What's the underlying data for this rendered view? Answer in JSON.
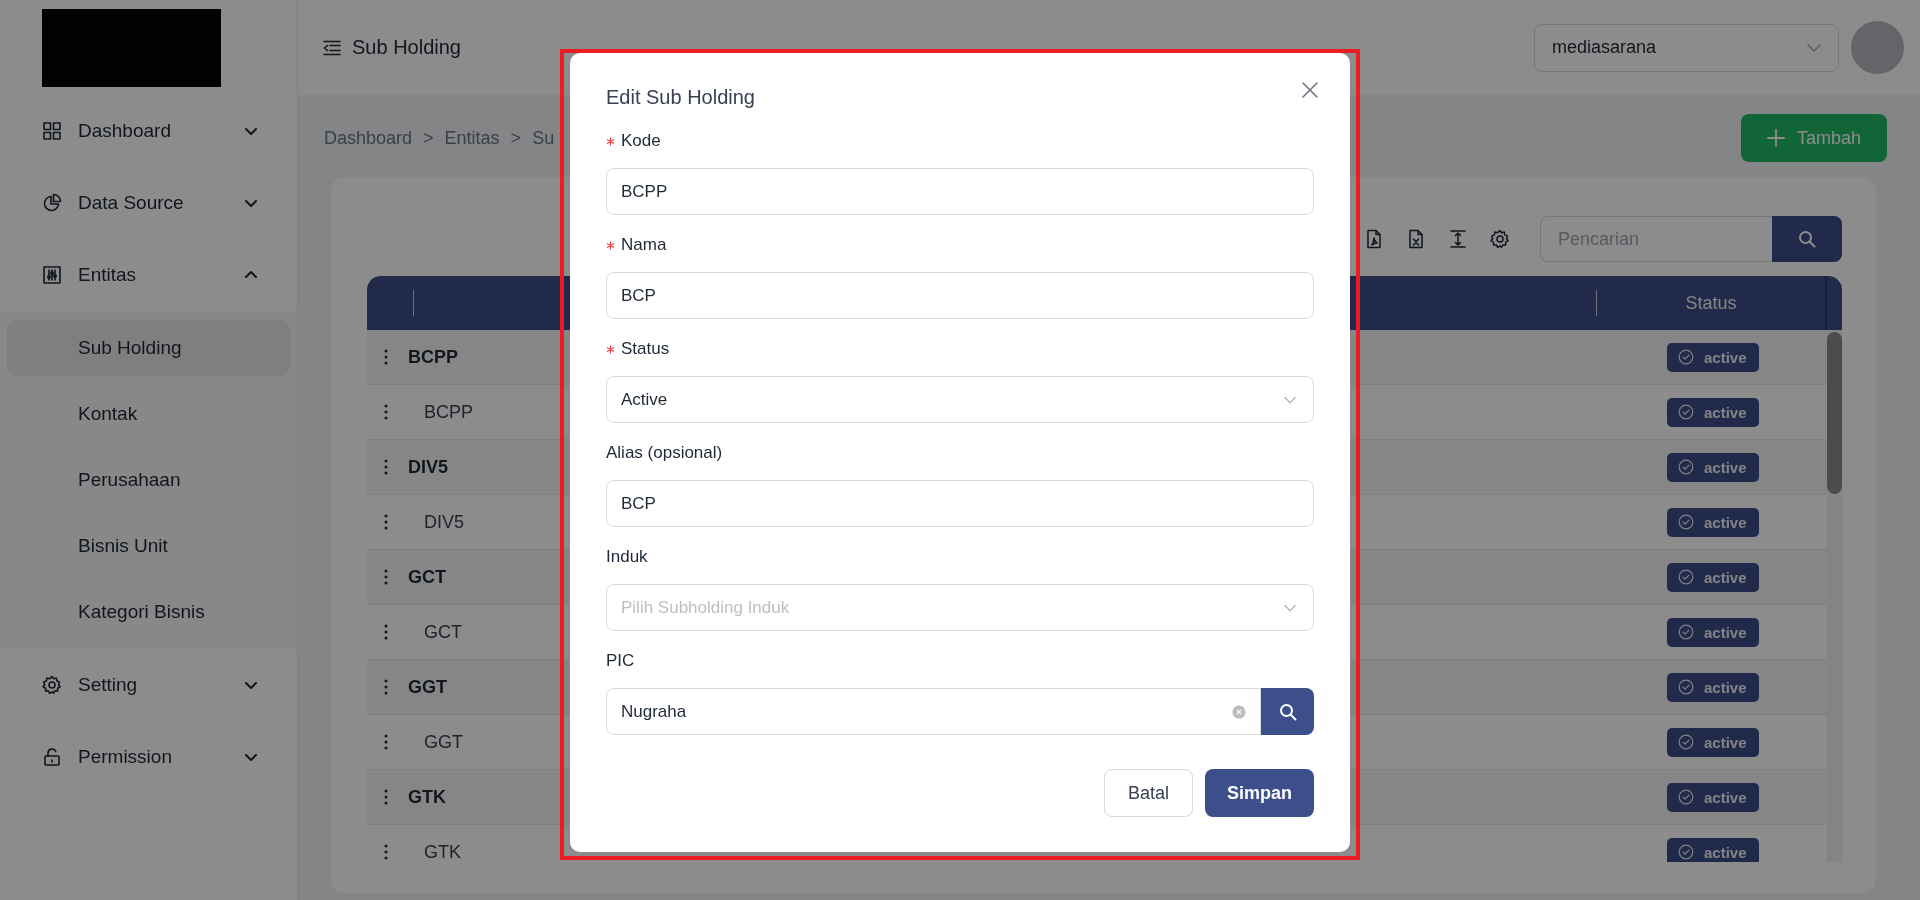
{
  "sidebar": {
    "items": [
      {
        "label": "Dashboard",
        "expanded": false
      },
      {
        "label": "Data Source",
        "expanded": false
      },
      {
        "label": "Entitas",
        "expanded": true,
        "children": [
          {
            "label": "Sub Holding",
            "selected": true
          },
          {
            "label": "Kontak",
            "selected": false
          },
          {
            "label": "Perusahaan",
            "selected": false
          },
          {
            "label": "Bisnis Unit",
            "selected": false
          },
          {
            "label": "Kategori Bisnis",
            "selected": false
          }
        ]
      },
      {
        "label": "Setting",
        "expanded": false
      },
      {
        "label": "Permission",
        "expanded": false
      }
    ]
  },
  "header": {
    "title": "Sub Holding",
    "company_select": {
      "value": "mediasarana"
    }
  },
  "breadcrumb": {
    "items": [
      "Dashboard",
      "Entitas",
      "Su"
    ],
    "separator": ">"
  },
  "add_button": {
    "label": "Tambah"
  },
  "search": {
    "placeholder": "Pencarian"
  },
  "table": {
    "status_header": "Status",
    "rows": [
      {
        "code": "BCPP",
        "status": "active",
        "children": [
          {
            "code": "BCPP",
            "status": "active"
          }
        ]
      },
      {
        "code": "DIV5",
        "status": "active",
        "children": [
          {
            "code": "DIV5",
            "status": "active"
          }
        ]
      },
      {
        "code": "GCT",
        "status": "active",
        "children": [
          {
            "code": "GCT",
            "status": "active"
          }
        ]
      },
      {
        "code": "GGT",
        "status": "active",
        "children": [
          {
            "code": "GGT",
            "status": "active"
          }
        ]
      },
      {
        "code": "GTK",
        "status": "active",
        "children": [
          {
            "code": "GTK",
            "status": "active"
          }
        ]
      }
    ]
  },
  "modal": {
    "title": "Edit Sub Holding",
    "fields": [
      {
        "kind": "input",
        "label": "Kode",
        "required": true,
        "value": "BCPP"
      },
      {
        "kind": "input",
        "label": "Nama",
        "required": true,
        "value": "BCP"
      },
      {
        "kind": "select",
        "label": "Status",
        "required": true,
        "value": "Active"
      },
      {
        "kind": "input",
        "label": "Alias (opsional)",
        "required": false,
        "value": "BCP"
      },
      {
        "kind": "select",
        "label": "Induk",
        "required": false,
        "placeholder": "Pilih Subholding Induk"
      },
      {
        "kind": "search",
        "label": "PIC",
        "required": false,
        "value": "Nugraha",
        "clearable": true
      }
    ],
    "buttons": [
      {
        "label": "Batal",
        "primary": false
      },
      {
        "label": "Simpan",
        "primary": true
      }
    ]
  }
}
